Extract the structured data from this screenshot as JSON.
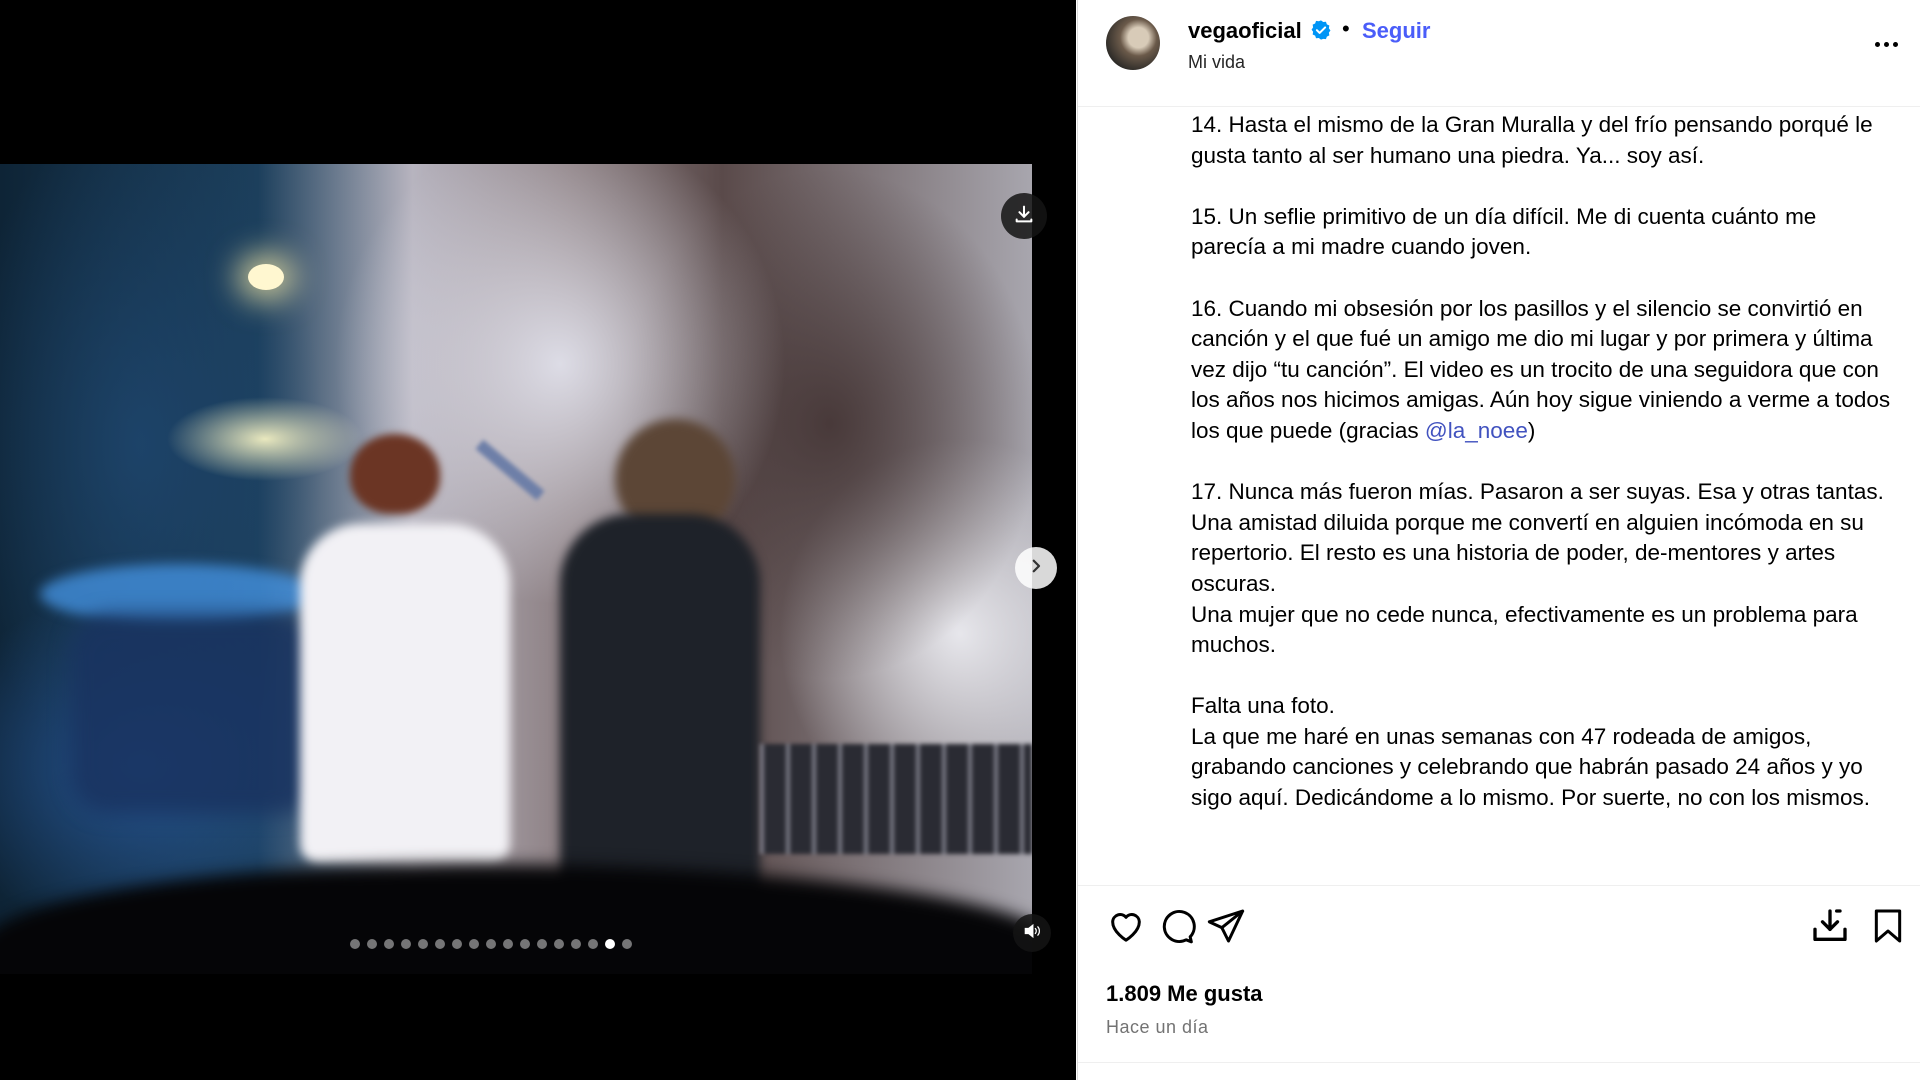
{
  "header": {
    "username": "vegaoficial",
    "separator": "•",
    "follow_label": "Seguir",
    "subtitle": "Mi vida"
  },
  "caption": {
    "p14": "14. Hasta el mismo de la Gran Muralla y del frío pensando porqué le gusta tanto al ser humano una piedra. Ya... soy así.",
    "p15": "15. Un seflie primitivo de un día difícil. Me di cuenta cuánto me parecía a mi madre cuando joven.",
    "p16_text": "16. Cuando mi obsesión por los pasillos y el silencio se convirtió en canción y el que fué un amigo me dio mi lugar y por primera y última vez dijo “tu canción”. El video es un trocito de una seguidora que con los años nos hicimos amigas. Aún hoy sigue viniendo a verme a todos los que puede (gracias ",
    "p16_mention": "@la_noee",
    "p16_end": ")",
    "p17a": "17. Nunca más fueron mías. Pasaron a ser suyas. Esa y otras tantas. Una amistad diluida porque me convertí en alguien incómoda en su repertorio. El resto es una historia de poder, de-mentores y artes oscuras.",
    "p17b": "Una mujer que no cede nunca, efectivamente es un problema para muchos.",
    "p18a": "Falta una foto.",
    "p18b": "La que me haré en unas semanas con 47 rodeada de amigos, grabando canciones y celebrando que habrán pasado 24 años y yo sigo aquí. Dedicándome a lo mismo. Por suerte, no con los mismos."
  },
  "stats": {
    "likes": "1.809 Me gusta",
    "time": "Hace un día"
  },
  "carousel": {
    "total_slides": 17,
    "active_slide": 16
  },
  "colors": {
    "accent": "#4a5df9",
    "mention": "#4152bf",
    "verified": "#0095f6"
  },
  "icons": {
    "download": "download-icon",
    "next": "chevron-right-icon",
    "sound": "speaker-icon",
    "like": "heart-icon",
    "comment": "comment-icon",
    "share": "send-icon",
    "save_download": "tray-download-icon",
    "bookmark": "bookmark-icon",
    "more": "more-icon",
    "verified": "verified-badge-icon"
  }
}
